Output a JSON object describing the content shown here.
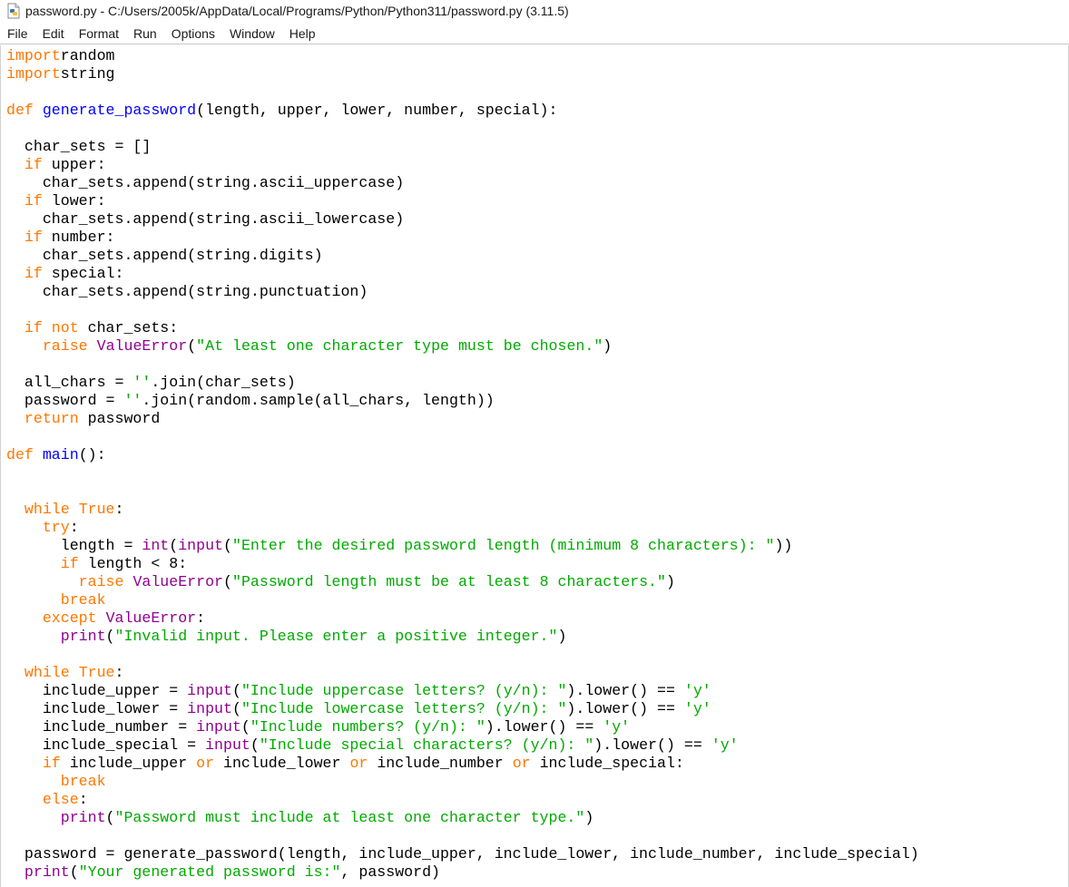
{
  "window": {
    "title": "password.py - C:/Users/2005k/AppData/Local/Programs/Python/Python311/password.py (3.11.5)",
    "icon": "python-file-icon"
  },
  "menu": [
    "File",
    "Edit",
    "Format",
    "Run",
    "Options",
    "Window",
    "Help"
  ],
  "colors": {
    "keyword": "#ff7700",
    "builtin": "#900090",
    "string": "#00aa00",
    "definition": "#0000ff",
    "default": "#000000"
  },
  "code_lines": [
    [
      [
        "kw",
        "import"
      ],
      [
        "",
        "random"
      ]
    ],
    [
      [
        "kw",
        "import"
      ],
      [
        "",
        "string"
      ]
    ],
    [],
    [
      [
        "kw",
        "def"
      ],
      [
        "",
        " "
      ],
      [
        "df",
        "generate_password"
      ],
      [
        "",
        "(length, upper, lower, number, special):"
      ]
    ],
    [],
    [
      [
        "",
        "  char_sets = []"
      ]
    ],
    [
      [
        "",
        "  "
      ],
      [
        "kw",
        "if"
      ],
      [
        "",
        " upper:"
      ]
    ],
    [
      [
        "",
        "    char_sets.append(string.ascii_uppercase)"
      ]
    ],
    [
      [
        "",
        "  "
      ],
      [
        "kw",
        "if"
      ],
      [
        "",
        " lower:"
      ]
    ],
    [
      [
        "",
        "    char_sets.append(string.ascii_lowercase)"
      ]
    ],
    [
      [
        "",
        "  "
      ],
      [
        "kw",
        "if"
      ],
      [
        "",
        " number:"
      ]
    ],
    [
      [
        "",
        "    char_sets.append(string.digits)"
      ]
    ],
    [
      [
        "",
        "  "
      ],
      [
        "kw",
        "if"
      ],
      [
        "",
        " special:"
      ]
    ],
    [
      [
        "",
        "    char_sets.append(string.punctuation)"
      ]
    ],
    [],
    [
      [
        "",
        "  "
      ],
      [
        "kw",
        "if not"
      ],
      [
        "",
        " char_sets:"
      ]
    ],
    [
      [
        "",
        "    "
      ],
      [
        "kw",
        "raise"
      ],
      [
        "",
        " "
      ],
      [
        "bi",
        "ValueError"
      ],
      [
        "",
        "("
      ],
      [
        "st",
        "\"At least one character type must be chosen.\""
      ],
      [
        "",
        ")"
      ]
    ],
    [],
    [
      [
        "",
        "  all_chars = "
      ],
      [
        "st",
        "''"
      ],
      [
        "",
        ".join(char_sets)"
      ]
    ],
    [
      [
        "",
        "  password = "
      ],
      [
        "st",
        "''"
      ],
      [
        "",
        ".join(random.sample(all_chars, length))"
      ]
    ],
    [
      [
        "",
        "  "
      ],
      [
        "kw",
        "return"
      ],
      [
        "",
        " password"
      ]
    ],
    [],
    [
      [
        "kw",
        "def"
      ],
      [
        "",
        " "
      ],
      [
        "df",
        "main"
      ],
      [
        "",
        "():"
      ]
    ],
    [],
    [],
    [
      [
        "",
        "  "
      ],
      [
        "kw",
        "while"
      ],
      [
        "",
        " "
      ],
      [
        "kw",
        "True"
      ],
      [
        "",
        ":"
      ]
    ],
    [
      [
        "",
        "    "
      ],
      [
        "kw",
        "try"
      ],
      [
        "",
        ":"
      ]
    ],
    [
      [
        "",
        "      length = "
      ],
      [
        "bi",
        "int"
      ],
      [
        "",
        "("
      ],
      [
        "bi",
        "input"
      ],
      [
        "",
        "("
      ],
      [
        "st",
        "\"Enter the desired password length (minimum 8 characters): \""
      ],
      [
        "",
        "))"
      ]
    ],
    [
      [
        "",
        "      "
      ],
      [
        "kw",
        "if"
      ],
      [
        "",
        " length < 8:"
      ]
    ],
    [
      [
        "",
        "        "
      ],
      [
        "kw",
        "raise"
      ],
      [
        "",
        " "
      ],
      [
        "bi",
        "ValueError"
      ],
      [
        "",
        "("
      ],
      [
        "st",
        "\"Password length must be at least 8 characters.\""
      ],
      [
        "",
        ")"
      ]
    ],
    [
      [
        "",
        "      "
      ],
      [
        "kw",
        "break"
      ]
    ],
    [
      [
        "",
        "    "
      ],
      [
        "kw",
        "except"
      ],
      [
        "",
        " "
      ],
      [
        "bi",
        "ValueError"
      ],
      [
        "",
        ":"
      ]
    ],
    [
      [
        "",
        "      "
      ],
      [
        "bi",
        "print"
      ],
      [
        "",
        "("
      ],
      [
        "st",
        "\"Invalid input. Please enter a positive integer.\""
      ],
      [
        "",
        ")"
      ]
    ],
    [],
    [
      [
        "",
        "  "
      ],
      [
        "kw",
        "while"
      ],
      [
        "",
        " "
      ],
      [
        "kw",
        "True"
      ],
      [
        "",
        ":"
      ]
    ],
    [
      [
        "",
        "    include_upper = "
      ],
      [
        "bi",
        "input"
      ],
      [
        "",
        "("
      ],
      [
        "st",
        "\"Include uppercase letters? (y/n): \""
      ],
      [
        "",
        ").lower() == "
      ],
      [
        "st",
        "'y'"
      ]
    ],
    [
      [
        "",
        "    include_lower = "
      ],
      [
        "bi",
        "input"
      ],
      [
        "",
        "("
      ],
      [
        "st",
        "\"Include lowercase letters? (y/n): \""
      ],
      [
        "",
        ").lower() == "
      ],
      [
        "st",
        "'y'"
      ]
    ],
    [
      [
        "",
        "    include_number = "
      ],
      [
        "bi",
        "input"
      ],
      [
        "",
        "("
      ],
      [
        "st",
        "\"Include numbers? (y/n): \""
      ],
      [
        "",
        ").lower() == "
      ],
      [
        "st",
        "'y'"
      ]
    ],
    [
      [
        "",
        "    include_special = "
      ],
      [
        "bi",
        "input"
      ],
      [
        "",
        "("
      ],
      [
        "st",
        "\"Include special characters? (y/n): \""
      ],
      [
        "",
        ").lower() == "
      ],
      [
        "st",
        "'y'"
      ]
    ],
    [
      [
        "",
        "    "
      ],
      [
        "kw",
        "if"
      ],
      [
        "",
        " include_upper "
      ],
      [
        "kw",
        "or"
      ],
      [
        "",
        " include_lower "
      ],
      [
        "kw",
        "or"
      ],
      [
        "",
        " include_number "
      ],
      [
        "kw",
        "or"
      ],
      [
        "",
        " include_special:"
      ]
    ],
    [
      [
        "",
        "      "
      ],
      [
        "kw",
        "break"
      ]
    ],
    [
      [
        "",
        "    "
      ],
      [
        "kw",
        "else"
      ],
      [
        "",
        ":"
      ]
    ],
    [
      [
        "",
        "      "
      ],
      [
        "bi",
        "print"
      ],
      [
        "",
        "("
      ],
      [
        "st",
        "\"Password must include at least one character type.\""
      ],
      [
        "",
        ")"
      ]
    ],
    [],
    [
      [
        "",
        "  password = generate_password(length, include_upper, include_lower, include_number, include_special)"
      ]
    ],
    [
      [
        "",
        "  "
      ],
      [
        "bi",
        "print"
      ],
      [
        "",
        "("
      ],
      [
        "st",
        "\"Your generated password is:\""
      ],
      [
        "",
        ", password)"
      ]
    ]
  ]
}
